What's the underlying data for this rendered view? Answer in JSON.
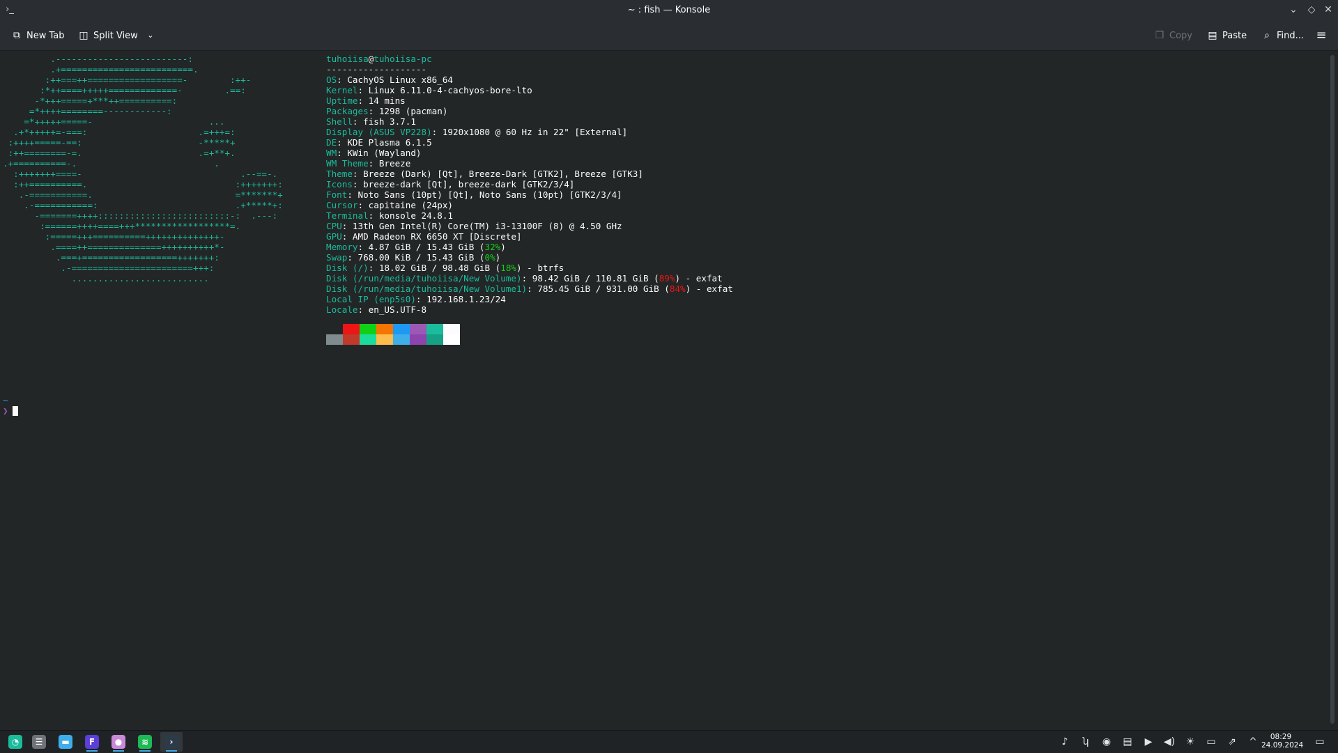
{
  "window": {
    "title": "~ : fish — Konsole"
  },
  "toolbar": {
    "new_tab": "New Tab",
    "split_view": "Split View",
    "copy": "Copy",
    "paste": "Paste",
    "find": "Find..."
  },
  "logo_art": "         .-------------------------:\n         .+=========================.\n        :++===++==================-        :++-\n       :*++====+++++=============-        .==:\n      -*+++=====+***++==========:\n     =*++++========------------:\n    =*+++++=====-                      ...\n  .+*+++++=-===:                     .=+++=:\n :++++=====-==:                      -*****+\n :++========-=.                      .=+**+.\n.+==========-.                          .\n  :+++++++====-                              .--==-.\n  :++==========.                            :+++++++:\n   .-===========.                           =*******+\n    .-===========:                          .+*****+:\n      -=======++++:::::::::::::::::::::::::-:  .---:\n       :======++++====+++******************=.\n        :=====+++==========++++++++++++++-\n         .====++==============++++++++++*-\n          .===+==================+++++++:\n           .-=======================+++:\n             ..........................",
  "neofetch": {
    "user": "tuhoiisa",
    "at": "@",
    "host": "tuhoiisa-pc",
    "separator": "-------------------",
    "rows": [
      {
        "key": "OS",
        "sep": ": ",
        "value": "CachyOS Linux x86_64"
      },
      {
        "key": "Kernel",
        "sep": ": ",
        "value": "Linux 6.11.0-4-cachyos-bore-lto"
      },
      {
        "key": "Uptime",
        "sep": ": ",
        "value": "14 mins"
      },
      {
        "key": "Packages",
        "sep": ": ",
        "value": "1298 (pacman)"
      },
      {
        "key": "Shell",
        "sep": ": ",
        "value": "fish 3.7.1"
      },
      {
        "key": "Display",
        "keyextra": " (ASUS VP228)",
        "sep": ": ",
        "value": "1920x1080 @ 60 Hz in 22\" [External]"
      },
      {
        "key": "DE",
        "sep": ": ",
        "value": "KDE Plasma 6.1.5"
      },
      {
        "key": "WM",
        "sep": ": ",
        "value": "KWin (Wayland)"
      },
      {
        "key": "WM Theme",
        "sep": ": ",
        "value": "Breeze"
      },
      {
        "key": "Theme",
        "sep": ": ",
        "value": "Breeze (Dark) [Qt], Breeze-Dark [GTK2], Breeze [GTK3]"
      },
      {
        "key": "Icons",
        "sep": ": ",
        "value": "breeze-dark [Qt], breeze-dark [GTK2/3/4]"
      },
      {
        "key": "Font",
        "sep": ": ",
        "value": "Noto Sans (10pt) [Qt], Noto Sans (10pt) [GTK2/3/4]"
      },
      {
        "key": "Cursor",
        "sep": ": ",
        "value": "capitaine (24px)"
      },
      {
        "key": "Terminal",
        "sep": ": ",
        "value": "konsole 24.8.1"
      },
      {
        "key": "CPU",
        "sep": ": ",
        "value": "13th Gen Intel(R) Core(TM) i3-13100F (8) @ 4.50 GHz"
      },
      {
        "key": "GPU",
        "sep": ": ",
        "value": "AMD Radeon RX 6650 XT [Discrete]"
      },
      {
        "key": "Memory",
        "sep": ": ",
        "value": "4.87 GiB / 15.43 GiB (",
        "pct": "32%",
        "pct_status": "ok",
        "tail": ")"
      },
      {
        "key": "Swap",
        "sep": ": ",
        "value": "768.00 KiB / 15.43 GiB (",
        "pct": "0%",
        "pct_status": "ok",
        "tail": ")"
      },
      {
        "key": "Disk",
        "keyextra": " (/)",
        "sep": ": ",
        "value": "18.02 GiB / 98.48 GiB (",
        "pct": "18%",
        "pct_status": "ok",
        "tail": ") - btrfs"
      },
      {
        "key": "Disk",
        "keyextra": " (/run/media/tuhoiisa/New Volume)",
        "sep": ": ",
        "value": "98.42 GiB / 110.81 GiB (",
        "pct": "89%",
        "pct_status": "bad",
        "tail": ") - exfat"
      },
      {
        "key": "Disk",
        "keyextra": " (/run/media/tuhoiisa/New Volume1)",
        "sep": ": ",
        "value": "785.45 GiB / 931.00 GiB (",
        "pct": "84%",
        "pct_status": "bad",
        "tail": ") - exfat"
      },
      {
        "key": "Local IP",
        "keyextra": " (enp5s0)",
        "sep": ": ",
        "value": "192.168.1.23/24"
      },
      {
        "key": "Locale",
        "sep": ": ",
        "value": "en_US.UTF-8"
      }
    ],
    "palette_top": [
      "#232627",
      "#ed1515",
      "#11d116",
      "#f67400",
      "#1d99f3",
      "#9b59b6",
      "#1abc9c",
      "#fcfcfc"
    ],
    "palette_bottom": [
      "#7f8c8d",
      "#c0392b",
      "#1cdc9a",
      "#fdbc4b",
      "#3daee9",
      "#8e44ad",
      "#16a085",
      "#ffffff"
    ]
  },
  "prompt": {
    "cwd": "~",
    "symbol": "❯"
  },
  "taskbar": {
    "apps": [
      {
        "name": "application-launcher-icon",
        "glyph": "◔",
        "color": "#1abc9c"
      },
      {
        "name": "task-manager-icon",
        "glyph": "☰",
        "color": "#6e7377"
      },
      {
        "name": "file-manager-icon",
        "glyph": "▬",
        "color": "#3daee9"
      },
      {
        "name": "firefox-icon",
        "glyph": "F",
        "color": "#5b3fd8"
      },
      {
        "name": "app-icon",
        "glyph": "●",
        "color": "#c88ad8"
      },
      {
        "name": "spotify-icon",
        "glyph": "≋",
        "color": "#1db954"
      },
      {
        "name": "konsole-icon",
        "glyph": "›",
        "color": "#2d3a48"
      }
    ],
    "tray": [
      {
        "name": "notification-icon",
        "glyph": "♪"
      },
      {
        "name": "network-tool-icon",
        "glyph": "ʮ"
      },
      {
        "name": "steam-icon",
        "glyph": "◉"
      },
      {
        "name": "clipboard-icon",
        "glyph": "▤"
      },
      {
        "name": "media-player-icon",
        "glyph": "▶"
      },
      {
        "name": "volume-icon",
        "glyph": "◀)"
      },
      {
        "name": "brightness-icon",
        "glyph": "☀"
      },
      {
        "name": "display-icon",
        "glyph": "▭"
      },
      {
        "name": "connect-icon",
        "glyph": "⇗"
      },
      {
        "name": "show-hidden-icon",
        "glyph": "^"
      }
    ],
    "clock": {
      "time": "08:29",
      "date": "24.09.2024"
    }
  }
}
